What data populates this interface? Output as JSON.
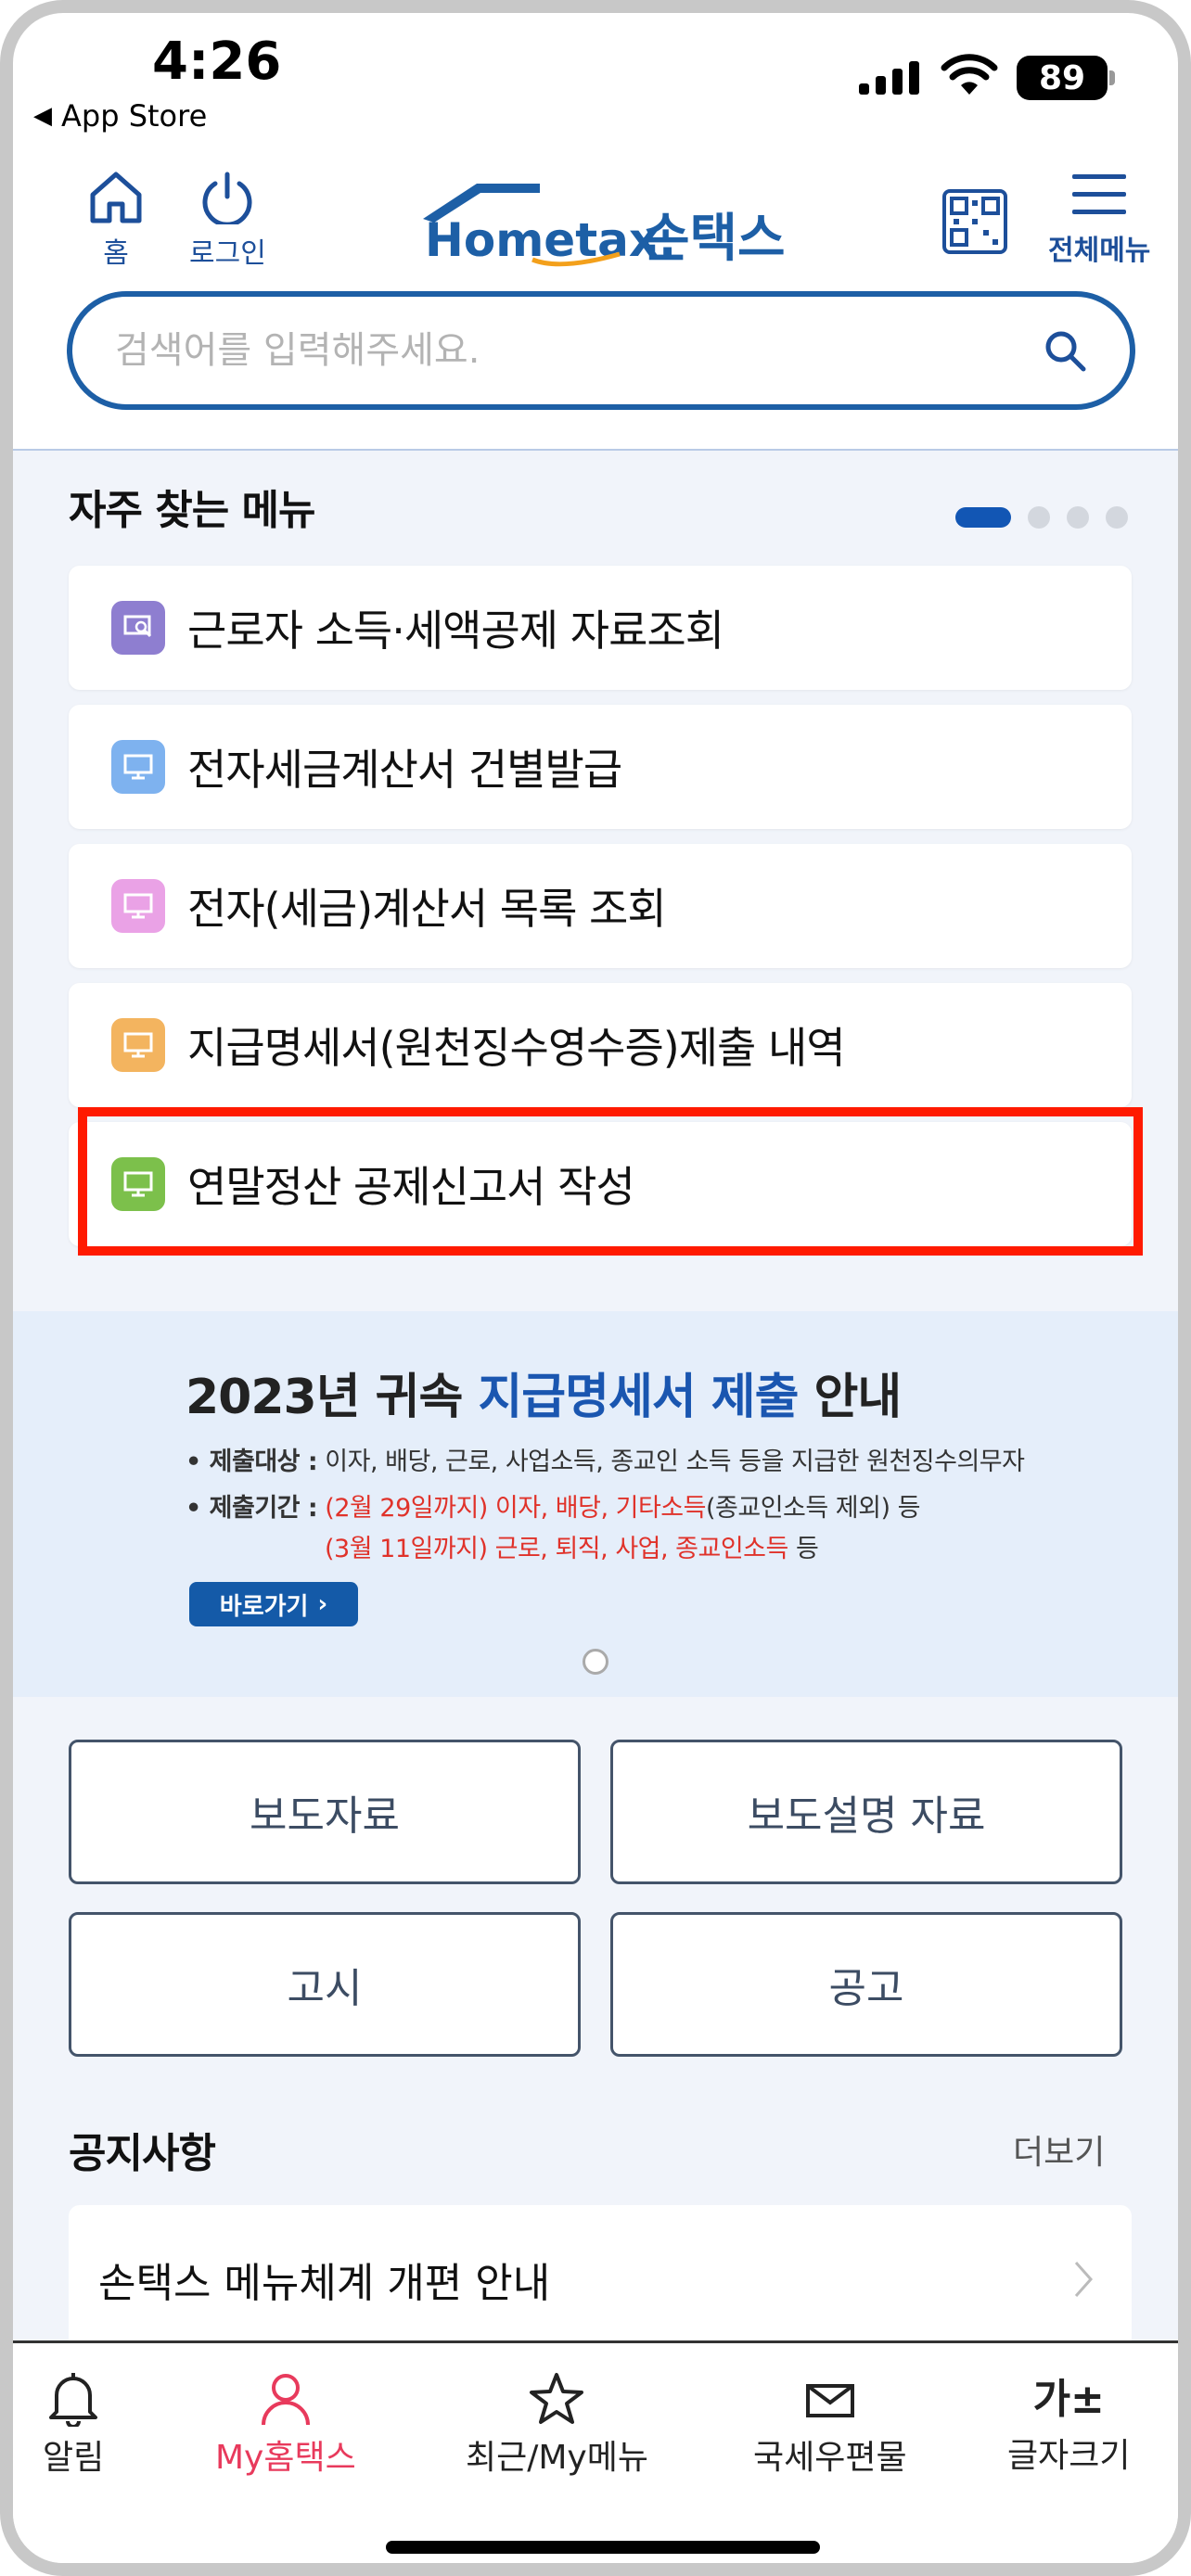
{
  "status": {
    "time": "4:26",
    "back_app": "App Store",
    "battery": "89"
  },
  "header": {
    "home_label": "홈",
    "login_label": "로그인",
    "logo_text": "Hometax.",
    "logo_korean": "손택스",
    "menu_label": "전체메뉴"
  },
  "search": {
    "placeholder": "검색어를 입력해주세요."
  },
  "favorites": {
    "title": "자주 찾는 메뉴",
    "items": [
      {
        "label": "근로자 소득·세액공제 자료조회",
        "color": "#8e7ed0"
      },
      {
        "label": "전자세금계산서 건별발급",
        "color": "#7eb2ef"
      },
      {
        "label": "전자(세금)계산서 목록 조회",
        "color": "#eaa2e6"
      },
      {
        "label": "지급명세서(원천징수영수증)제출 내역",
        "color": "#f3b45f"
      },
      {
        "label": "연말정산 공제신고서 작성",
        "color": "#7cc04b"
      }
    ]
  },
  "banner": {
    "title_prefix": "2023년 귀속 ",
    "title_highlight": "지급명세서 제출",
    "title_suffix": " 안내",
    "target_label": "• 제출대상 :",
    "target_text": " 이자, 배당, 근로, 사업소득, 종교인 소득 등을 지급한 원천징수의무자",
    "period_label": "• 제출기간 :",
    "period_red1": " (2월 29일까지) 이자, 배당, 기타소득",
    "period_text1": "(종교인소득 제외) 등",
    "period_red2": "(3월 11일까지) 근로, 퇴직, 사업, 종교인소득",
    "period_text2": " 등",
    "go_label": "바로가기"
  },
  "quick_buttons": [
    "보도자료",
    "보도설명 자료",
    "고시",
    "공고"
  ],
  "notice": {
    "title": "공지사항",
    "more": "더보기",
    "items": [
      "손택스 메뉴체계 개편 안내"
    ]
  },
  "tabbar": {
    "items": [
      {
        "label": "알림"
      },
      {
        "label": "My홈택스"
      },
      {
        "label": "최근/My메뉴"
      },
      {
        "label": "국세우편물"
      },
      {
        "label": "글자크기",
        "glyph": "가±"
      }
    ]
  },
  "colors": {
    "brand": "#1d4f9a",
    "accent": "#e83a5c",
    "highlight": "#ff1a00"
  }
}
